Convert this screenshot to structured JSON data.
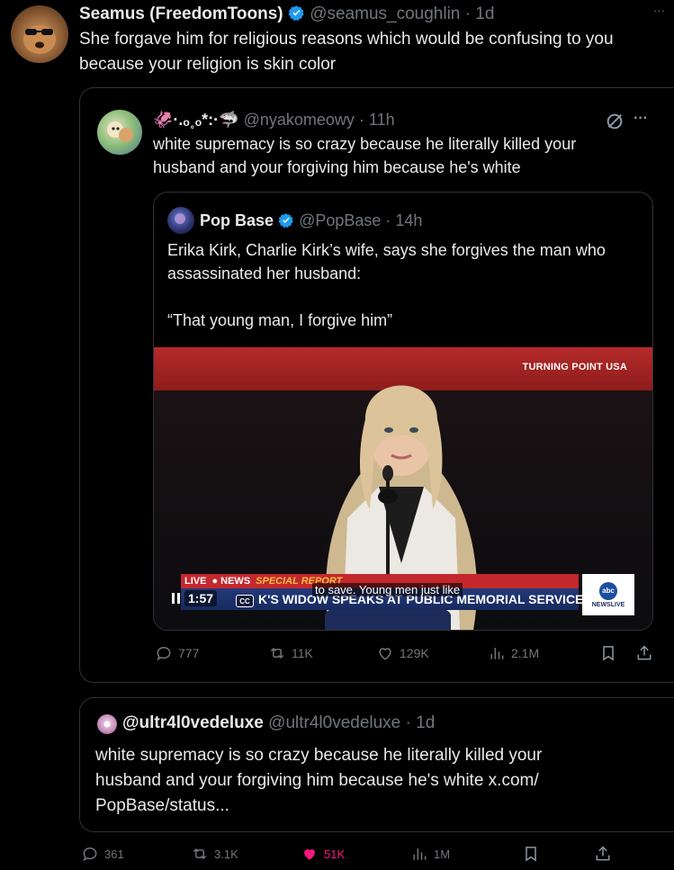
{
  "main_tweet": {
    "display_name": "Seamus (FreedomToons)",
    "handle": "@seamus_coughlin",
    "time": "1d",
    "text_line1": "She forgave him for religious reasons which would be confusing to you",
    "text_line2": "because your religion is skin color",
    "more": "···"
  },
  "quoted_tweet": {
    "display_name": "🦑·.ₒ˳ₒ*:·🦈",
    "handle": "@nyakomeowy",
    "time": "11h",
    "more": "···",
    "text_line1": "white supremacy is so crazy because he literally killed your",
    "text_line2": "husband and your forgiving him because he's white",
    "stats": {
      "replies": "777",
      "reposts": "11K",
      "likes": "129K",
      "views": "2.1M"
    }
  },
  "nested_quote": {
    "display_name": "Pop Base",
    "handle": "@PopBase",
    "time": "14h",
    "text_line1": "Erika Kirk, Charlie Kirk’s wife, says she forgives the man who",
    "text_line2": "assassinated her husband:",
    "quote": "“That young man, I forgive him”"
  },
  "video": {
    "banner_text": "TURNING POINT USA",
    "live_label": "LIVE",
    "news_label": "NEWS",
    "special_report": "SPECIAL REPORT",
    "caption": "to save. Young men just like",
    "ticker": "K'S WIDOW SPEAKS AT PUBLIC MEMORIAL SERVICE",
    "timestamp": "1:57",
    "cc": "CC",
    "logo_line1": "abc",
    "logo_line2": "NEWSLIVE"
  },
  "reply_card": {
    "handle_name": "@ultr4l0vedeluxe",
    "handle": "@ultr4l0vedeluxe",
    "time": "1d",
    "text_line1": "white supremacy is so crazy because he literally killed your",
    "text_line2": "husband and your forgiving him because he's white x.com/",
    "text_line3": "PopBase/status..."
  },
  "main_stats": {
    "replies": "361",
    "reposts": "3.1K",
    "likes": "51K",
    "views": "1M"
  },
  "colors": {
    "verified": "#1d9bf0",
    "like_active": "#f91880",
    "muted": "#71767b"
  }
}
